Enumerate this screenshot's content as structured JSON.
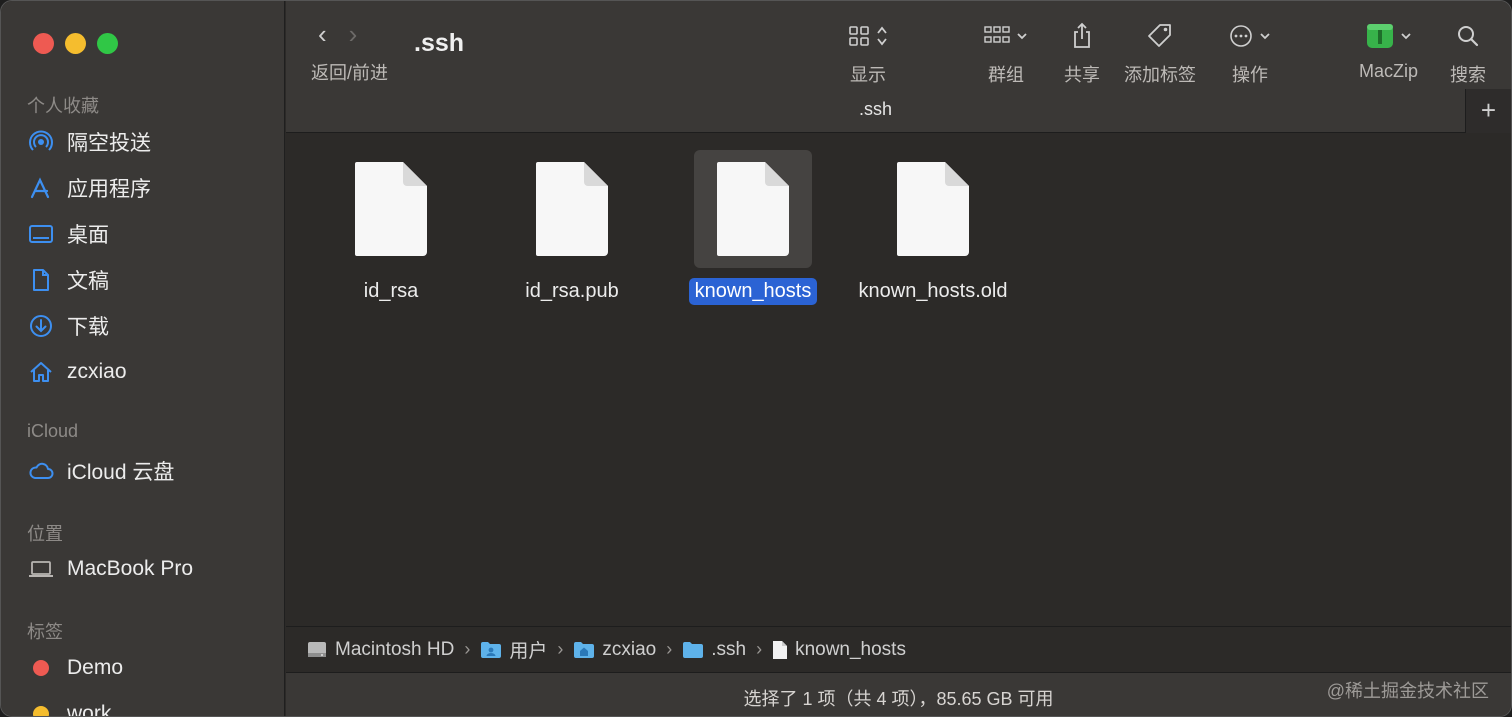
{
  "sidebar": {
    "favorites_title": "个人收藏",
    "favorites": [
      {
        "label": "隔空投送",
        "icon": "airdrop-icon"
      },
      {
        "label": "应用程序",
        "icon": "applications-icon"
      },
      {
        "label": "桌面",
        "icon": "desktop-icon"
      },
      {
        "label": "文稿",
        "icon": "document-icon"
      },
      {
        "label": "下载",
        "icon": "download-icon"
      },
      {
        "label": "zcxiao",
        "icon": "home-icon"
      }
    ],
    "icloud_title": "iCloud",
    "icloud": [
      {
        "label": "iCloud 云盘",
        "icon": "cloud-icon"
      }
    ],
    "locations_title": "位置",
    "locations": [
      {
        "label": "MacBook Pro",
        "icon": "laptop-icon"
      }
    ],
    "tags_title": "标签",
    "tags": [
      {
        "label": "Demo",
        "color": "#ee5a52"
      },
      {
        "label": "work",
        "color": "#f5bd2e"
      }
    ]
  },
  "toolbar": {
    "nav_label": "返回/前进",
    "folder_title": ".ssh",
    "view_label": "显示",
    "group_label": "群组",
    "share_label": "共享",
    "tags_label": "添加标签",
    "action_label": "操作",
    "maczip_label": "MacZip",
    "search_label": "搜索"
  },
  "tab": {
    "title": ".ssh",
    "plus": "+"
  },
  "files": [
    {
      "name": "id_rsa",
      "selected": false
    },
    {
      "name": "id_rsa.pub",
      "selected": false
    },
    {
      "name": "known_hosts",
      "selected": true
    },
    {
      "name": "known_hosts.old",
      "selected": false
    }
  ],
  "path": [
    {
      "label": "Macintosh HD",
      "icon": "hard-drive-icon"
    },
    {
      "label": "用户",
      "icon": "users-folder-icon"
    },
    {
      "label": "zcxiao",
      "icon": "home-folder-icon"
    },
    {
      "label": ".ssh",
      "icon": "folder-icon"
    },
    {
      "label": "known_hosts",
      "icon": "file-icon"
    }
  ],
  "status": {
    "text": "选择了 1 项（共 4 项），85.65 GB 可用"
  },
  "watermark": "@稀土掘金技术社区",
  "colors": {
    "accent": "#2b63d4",
    "sidebar_icon": "#3d8ff0"
  }
}
